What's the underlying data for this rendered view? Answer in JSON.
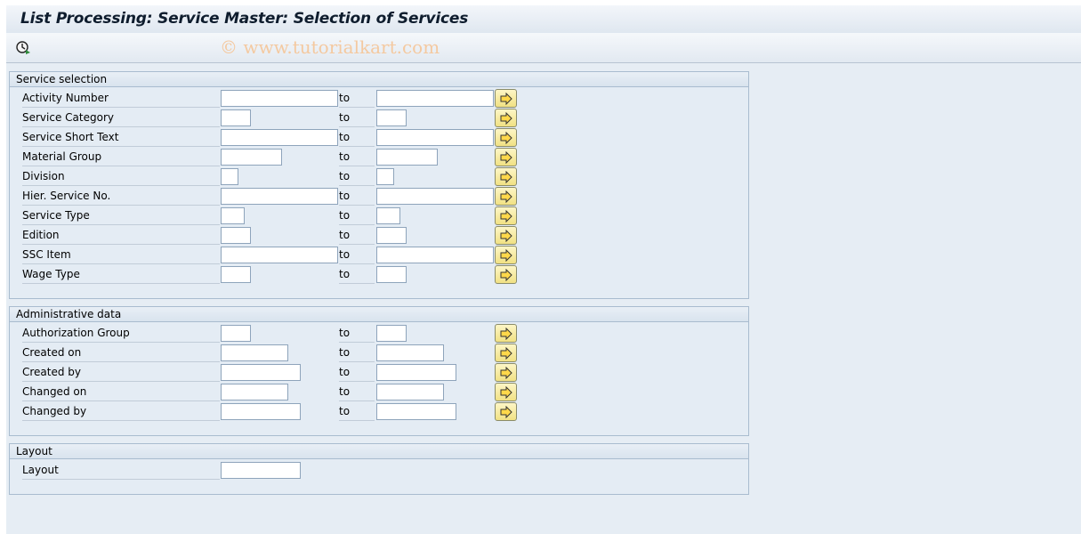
{
  "window": {
    "title": "List Processing: Service Master: Selection of Services"
  },
  "toolbar": {
    "execute_icon": "execute-clock-icon",
    "watermark": "© www.tutorialkart.com"
  },
  "service_selection": {
    "header": "Service selection",
    "rows": [
      {
        "label": "Activity Number",
        "to": "to",
        "from_value": "",
        "to_value": ""
      },
      {
        "label": "Service Category",
        "to": "to",
        "from_value": "",
        "to_value": ""
      },
      {
        "label": "Service Short Text",
        "to": "to",
        "from_value": "",
        "to_value": ""
      },
      {
        "label": "Material Group",
        "to": "to",
        "from_value": "",
        "to_value": ""
      },
      {
        "label": "Division",
        "to": "to",
        "from_value": "",
        "to_value": ""
      },
      {
        "label": "Hier. Service No.",
        "to": "to",
        "from_value": "",
        "to_value": ""
      },
      {
        "label": "Service Type",
        "to": "to",
        "from_value": "",
        "to_value": ""
      },
      {
        "label": "Edition",
        "to": "to",
        "from_value": "",
        "to_value": ""
      },
      {
        "label": "SSC Item",
        "to": "to",
        "from_value": "",
        "to_value": ""
      },
      {
        "label": "Wage Type",
        "to": "to",
        "from_value": "",
        "to_value": ""
      }
    ]
  },
  "administrative_data": {
    "header": "Administrative data",
    "rows": [
      {
        "label": "Authorization Group",
        "to": "to",
        "from_value": "",
        "to_value": ""
      },
      {
        "label": "Created on",
        "to": "to",
        "from_value": "",
        "to_value": ""
      },
      {
        "label": "Created by",
        "to": "to",
        "from_value": "",
        "to_value": ""
      },
      {
        "label": "Changed on",
        "to": "to",
        "from_value": "",
        "to_value": ""
      },
      {
        "label": "Changed by",
        "to": "to",
        "from_value": "",
        "to_value": ""
      }
    ]
  },
  "layout": {
    "header": "Layout",
    "row": {
      "label": "Layout",
      "value": ""
    }
  },
  "colors": {
    "background": "#e6edf4",
    "group_border": "#a9bccf",
    "multi_button": "#f1e183"
  }
}
